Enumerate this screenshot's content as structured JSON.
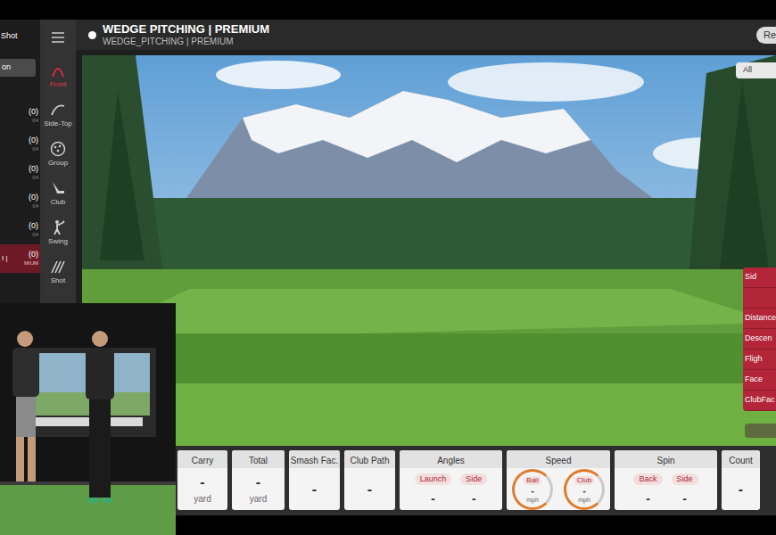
{
  "header": {
    "title": "WEDGE PITCHING | PREMIUM",
    "subtitle": "WEDGE_PITCHING | PREMIUM",
    "button": "Re"
  },
  "left_panel": {
    "title": "Shot",
    "button": "on",
    "rows": [
      {
        "count": "(0)",
        "sub": "04",
        "selected": false
      },
      {
        "count": "(0)",
        "sub": "04",
        "selected": false
      },
      {
        "count": "(0)",
        "sub": "04",
        "selected": false
      },
      {
        "count": "(0)",
        "sub": "04",
        "selected": false
      },
      {
        "count": "(0)",
        "sub": "04",
        "selected": false
      },
      {
        "label": "I |",
        "count": "(0)",
        "sub": "MIUM",
        "selected": true
      }
    ]
  },
  "nav": [
    {
      "label": "Front",
      "selected": true
    },
    {
      "label": "Side-Top",
      "selected": false
    },
    {
      "label": "Group",
      "selected": false
    },
    {
      "label": "Club",
      "selected": false
    },
    {
      "label": "Swing",
      "selected": false
    },
    {
      "label": "Shot",
      "selected": false
    }
  ],
  "scene": {
    "filter": "All",
    "data_panel": [
      {
        "label": "Sid"
      },
      {
        "label": ""
      },
      {
        "label": "Distance"
      },
      {
        "label": "Descen"
      },
      {
        "label": "Fligh"
      },
      {
        "label": "Face"
      },
      {
        "label": "ClubFac"
      }
    ]
  },
  "stats": [
    {
      "kind": "single",
      "title": "Carry",
      "value": "-",
      "unit": "yard"
    },
    {
      "kind": "single",
      "title": "Total",
      "value": "-",
      "unit": "yard"
    },
    {
      "kind": "single",
      "title": "Smash Fac.",
      "value": "-"
    },
    {
      "kind": "single",
      "title": "Club Path",
      "value": "-"
    },
    {
      "kind": "pair",
      "title": "Angles",
      "items": [
        {
          "label": "Launch",
          "value": "-"
        },
        {
          "label": "Side",
          "value": "-"
        }
      ]
    },
    {
      "kind": "gauge",
      "title": "Speed",
      "items": [
        {
          "label": "Ball",
          "value": "-",
          "unit": "mph"
        },
        {
          "label": "Club",
          "value": "-",
          "unit": "mph"
        }
      ]
    },
    {
      "kind": "pair",
      "title": "Spin",
      "items": [
        {
          "label": "Back",
          "value": "-"
        },
        {
          "label": "Side",
          "value": "-"
        }
      ]
    },
    {
      "kind": "single",
      "title": "Count",
      "value": "-"
    }
  ]
}
